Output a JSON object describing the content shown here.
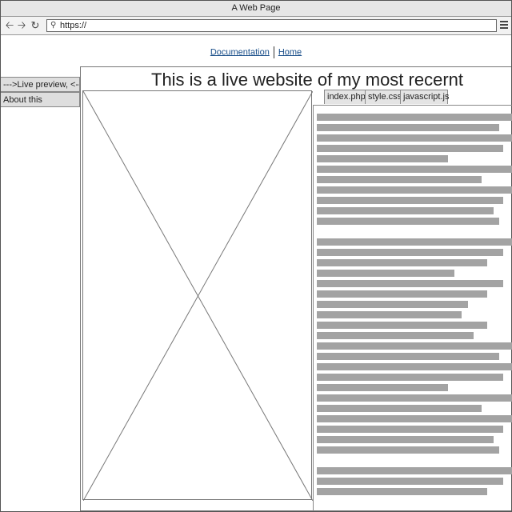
{
  "window": {
    "title": "A Web Page"
  },
  "browser": {
    "back_icon": "arrow-left-icon",
    "forward_icon": "arrow-right-icon",
    "reload_icon": "reload-icon",
    "url": "https://",
    "menu_icon": "hamburger-menu-icon"
  },
  "nav": {
    "links": [
      {
        "label": "Documentation"
      },
      {
        "label": "Home"
      }
    ]
  },
  "sidebar": {
    "items": [
      {
        "label": "--->Live preview, <---"
      },
      {
        "label": "About this"
      }
    ]
  },
  "main": {
    "heading": "This is a live website of my most recernt",
    "preview": {
      "type": "image-placeholder"
    },
    "tabs": [
      {
        "label": "index.php"
      },
      {
        "label": "style.css"
      },
      {
        "label": "javascript.js"
      }
    ],
    "code_line_groups": [
      {
        "line_widths": [
          1.0,
          0.93,
          1.0,
          0.95,
          0.67,
          1.0,
          0.84,
          1.0,
          0.95,
          0.9,
          0.93
        ]
      },
      {
        "line_widths": [
          1.0,
          0.95,
          0.87,
          0.7,
          0.95,
          0.87,
          0.77,
          0.74,
          0.87,
          0.8,
          1.0,
          0.93,
          1.0,
          0.95,
          0.67,
          1.0,
          0.84,
          1.0,
          0.95,
          0.9,
          0.93
        ]
      },
      {
        "line_widths": [
          1.0,
          0.95,
          0.87
        ]
      }
    ]
  }
}
